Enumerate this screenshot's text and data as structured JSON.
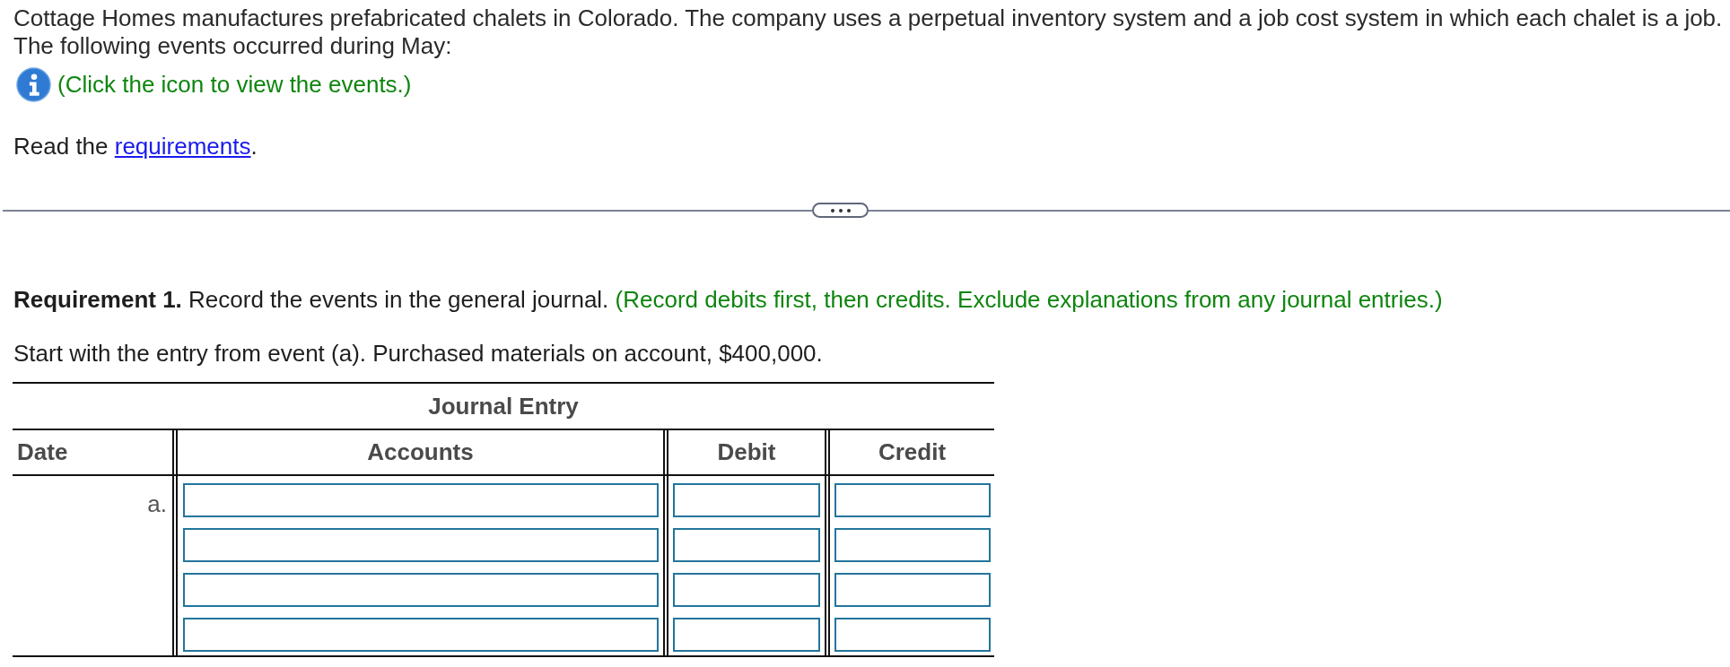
{
  "intro": {
    "text": "Cottage Homes manufactures prefabricated chalets in Colorado. The company uses a perpetual inventory system and a job cost system in which each chalet is a job. The following events occurred during May:"
  },
  "events_hint": {
    "text": "(Click the icon to view the events.)"
  },
  "requirements_line": {
    "prefix": "Read the ",
    "link": "requirements",
    "suffix": "."
  },
  "requirement": {
    "text": "**Requirement 1.** Record the events in the general journal.",
    "instruction": "(Record debits first, then credits. Exclude explanations from any journal entries.)"
  },
  "start_text": "Start with the entry from event (a). Purchased materials on account, $400,000.",
  "journal": {
    "title": "Journal Entry",
    "columns": [
      "Date",
      "Accounts",
      "Debit",
      "Credit"
    ],
    "rows": [
      {
        "date": "a."
      },
      {},
      {},
      {}
    ]
  }
}
